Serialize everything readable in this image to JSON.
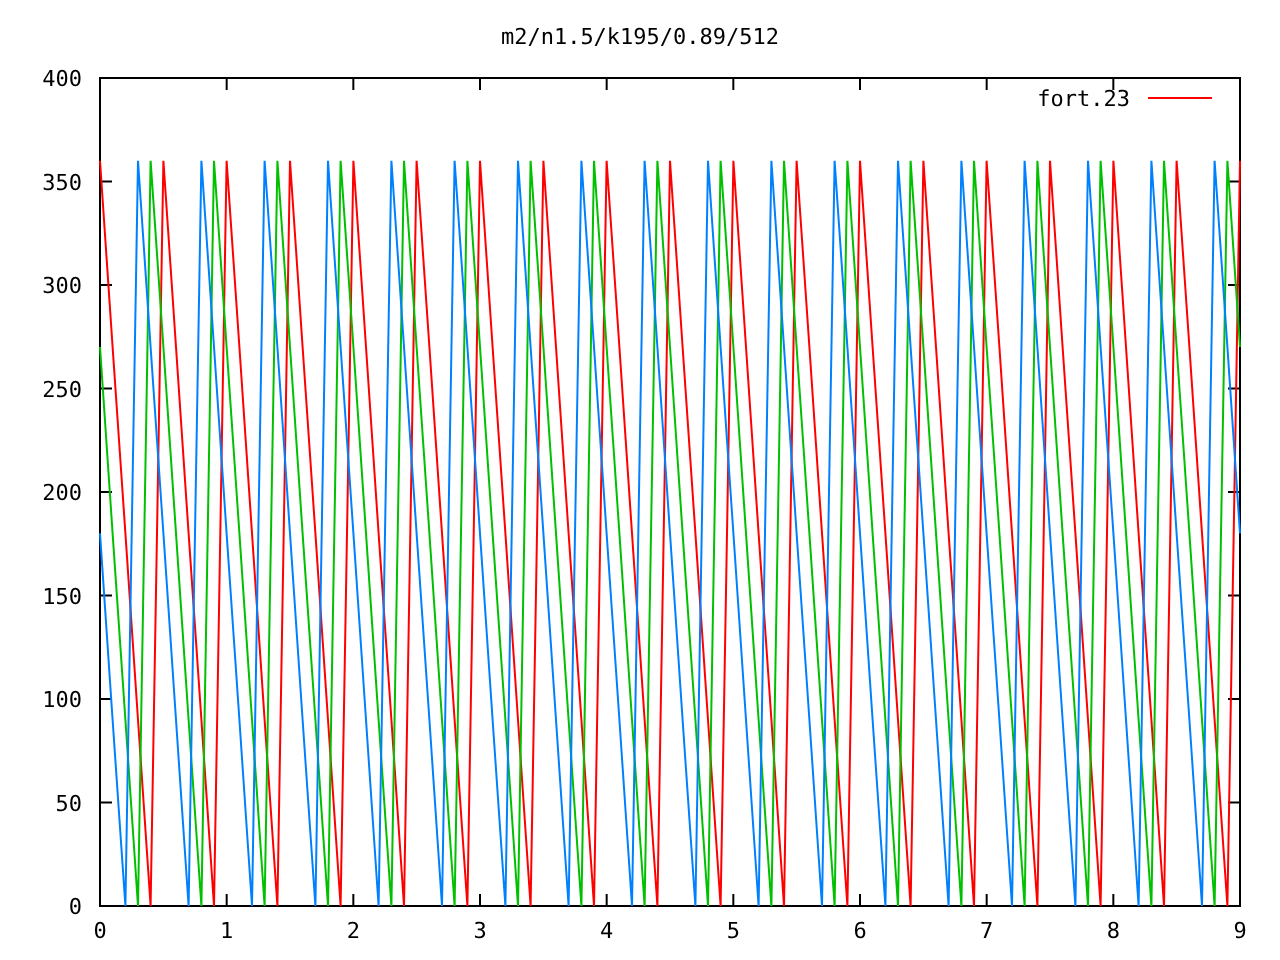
{
  "chart": {
    "chart_data": {
      "type": "line",
      "title": "m2/n1.5/k195/0.89/512",
      "xlim": [
        0,
        9
      ],
      "ylim": [
        0,
        400
      ],
      "xticks": [
        0,
        1,
        2,
        3,
        4,
        5,
        6,
        7,
        8,
        9
      ],
      "yticks": [
        0,
        50,
        100,
        150,
        200,
        250,
        300,
        350,
        400
      ],
      "x": [
        0,
        0.1,
        0.2,
        0.3,
        0.4,
        0.5,
        0.6,
        0.7,
        0.8,
        0.9,
        1,
        1.1,
        1.2,
        1.3,
        1.4,
        1.5,
        1.6,
        1.7,
        1.8,
        1.9,
        2,
        2.1,
        2.2,
        2.3,
        2.4,
        2.5,
        2.6,
        2.7,
        2.8,
        2.9,
        3,
        3.1,
        3.2,
        3.3,
        3.4,
        3.5,
        3.6,
        3.7,
        3.8,
        3.9,
        4,
        4.1,
        4.2,
        4.3,
        4.4,
        4.5,
        4.6,
        4.7,
        4.8,
        4.9,
        5,
        5.1,
        5.2,
        5.3,
        5.4,
        5.5,
        5.6,
        5.7,
        5.8,
        5.9,
        6,
        6.1,
        6.2,
        6.3,
        6.4,
        6.5,
        6.6,
        6.7,
        6.8,
        6.9,
        7,
        7.1,
        7.2,
        7.3,
        7.4,
        7.5,
        7.6,
        7.7,
        7.8,
        7.9,
        8,
        8.1,
        8.2,
        8.3,
        8.4,
        8.5,
        8.6,
        8.7,
        8.8,
        8.9,
        9
      ],
      "series": [
        {
          "name": "fort.23",
          "color": "#ff0000",
          "values": [
            360,
            270,
            180,
            90,
            0,
            360,
            270,
            180,
            90,
            0,
            360,
            270,
            180,
            90,
            0,
            360,
            270,
            180,
            90,
            0,
            360,
            270,
            180,
            90,
            0,
            360,
            270,
            180,
            90,
            0,
            360,
            270,
            180,
            90,
            0,
            360,
            270,
            180,
            90,
            0,
            360,
            270,
            180,
            90,
            0,
            360,
            270,
            180,
            90,
            0,
            360,
            270,
            180,
            90,
            0,
            360,
            270,
            180,
            90,
            0,
            360,
            270,
            180,
            90,
            0,
            360,
            270,
            180,
            90,
            0,
            360,
            270,
            180,
            90,
            0,
            360,
            270,
            180,
            90,
            0,
            360,
            270,
            180,
            90,
            0,
            360,
            270,
            180,
            90,
            0,
            360
          ]
        },
        {
          "color": "#00c000",
          "values": [
            270,
            180,
            90,
            0,
            360,
            270,
            180,
            90,
            0,
            360,
            270,
            180,
            90,
            0,
            360,
            270,
            180,
            90,
            0,
            360,
            270,
            180,
            90,
            0,
            360,
            270,
            180,
            90,
            0,
            360,
            270,
            180,
            90,
            0,
            360,
            270,
            180,
            90,
            0,
            360,
            270,
            180,
            90,
            0,
            360,
            270,
            180,
            90,
            0,
            360,
            270,
            180,
            90,
            0,
            360,
            270,
            180,
            90,
            0,
            360,
            270,
            180,
            90,
            0,
            360,
            270,
            180,
            90,
            0,
            360,
            270,
            180,
            90,
            0,
            360,
            270,
            180,
            90,
            0,
            360,
            270,
            180,
            90,
            0,
            360,
            270,
            180,
            90,
            0,
            360,
            270
          ]
        },
        {
          "color": "#0080ff",
          "values": [
            180,
            90,
            0,
            360,
            270,
            180,
            90,
            0,
            360,
            270,
            180,
            90,
            0,
            360,
            270,
            180,
            90,
            0,
            360,
            270,
            180,
            90,
            0,
            360,
            270,
            180,
            90,
            0,
            360,
            270,
            180,
            90,
            0,
            360,
            270,
            180,
            90,
            0,
            360,
            270,
            180,
            90,
            0,
            360,
            270,
            180,
            90,
            0,
            360,
            270,
            180,
            90,
            0,
            360,
            270,
            180,
            90,
            0,
            360,
            270,
            180,
            90,
            0,
            360,
            270,
            180,
            90,
            0,
            360,
            270,
            180,
            90,
            0,
            360,
            270,
            180,
            90,
            0,
            360,
            270,
            180,
            90,
            0,
            360,
            270,
            180,
            90,
            0,
            360,
            270,
            180
          ]
        }
      ]
    }
  }
}
